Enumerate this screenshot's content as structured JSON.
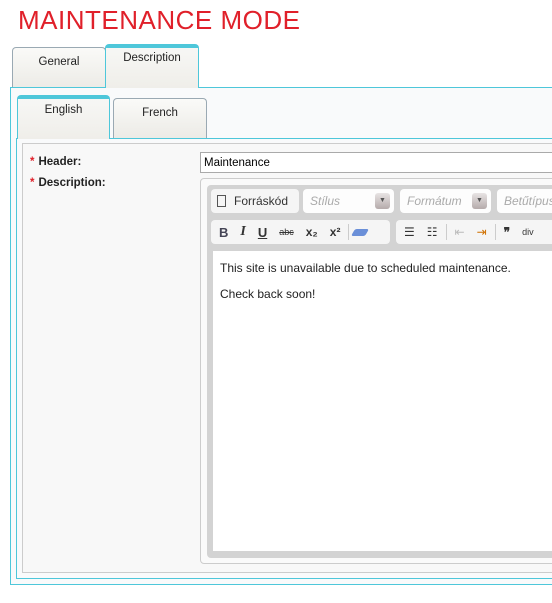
{
  "title": "MAINTENANCE MODE",
  "tabs": [
    {
      "label": "General",
      "active": false
    },
    {
      "label": "Description",
      "active": true
    }
  ],
  "lang_tabs": [
    {
      "label": "English",
      "active": true
    },
    {
      "label": "French",
      "active": false
    }
  ],
  "form": {
    "header_label": "Header:",
    "header_value": "Maintenance",
    "description_label": "Description:",
    "required_mark": "*"
  },
  "editor": {
    "source_label": "Forráskód",
    "style_placeholder": "Stílus",
    "format_placeholder": "Formátum",
    "font_placeholder": "Betűtípus",
    "buttons": {
      "bold": "B",
      "italic": "I",
      "underline": "U",
      "strike": "abc",
      "sub": "x₂",
      "sup": "x²",
      "numbered_list": "☰",
      "bullet_list": "☷",
      "outdent": "⇤",
      "indent": "⇥",
      "blockquote": "❞",
      "div": "div"
    },
    "content": [
      "This site is unavailable due to scheduled maintenance.",
      "Check back soon!"
    ]
  },
  "colors": {
    "accent": "#4ec7da",
    "title": "#e0202a"
  }
}
